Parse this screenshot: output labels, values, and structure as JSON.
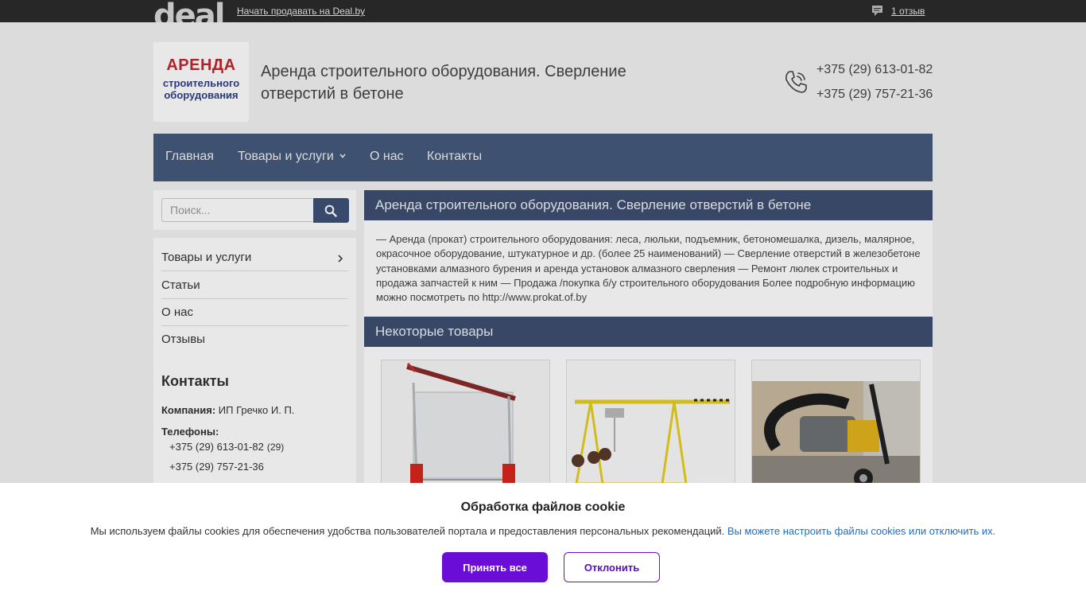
{
  "topbar": {
    "logo_text": "deal",
    "sell_link": "Начать продавать на Deal.by",
    "reviews_link": "1 отзыв",
    "comment_icon": "comment-icon"
  },
  "header": {
    "logo_lines": [
      "АРЕНДА",
      "строительного",
      "оборудования"
    ],
    "title": "Аренда строительного оборудования. Сверление отверстий в бетоне",
    "phone_icon": "phone-icon",
    "phones": [
      "+375 (29) 613-01-82",
      "+375 (29) 757-21-36"
    ]
  },
  "nav": {
    "items": [
      "Главная",
      "Товары и услуги",
      "О нас",
      "Контакты"
    ],
    "dropdown_icon": "chevron-down-icon"
  },
  "search": {
    "placeholder": "Поиск...",
    "button_icon": "search-icon"
  },
  "sidebar": {
    "items": [
      "Товары и услуги",
      "Статьи",
      "О нас",
      "Отзывы"
    ],
    "contacts_title": "Контакты",
    "company_label": "Компания:",
    "company_value": "ИП Гречко И. П.",
    "phones_label": "Телефоны:",
    "phones": [
      "+375 (29) 613-01-82",
      "+375 (29) 757-21-36"
    ],
    "phone_note": "(29)"
  },
  "main": {
    "heading": "Аренда строительного оборудования. Сверление отверстий в бетоне",
    "description": "— Аренда (прокат) строительного оборудования: леса, люльки, подъемник, бетономешалка, дизель, малярное, окрасочное оборудование, штукатурное и др. (более 25 наименований) — Сверление отверстий в железобетоне установками алмазного бурения и аренда установок алмазного сверления — Ремонт люлек строительных и продажа запчастей к ним — Продажа /покупка б/у строительного оборудования Более подробную информацию можно посмотреть по http://www.prokat.of.by",
    "products_heading": "Некоторые товары"
  },
  "cookie": {
    "title": "Обработка файлов cookie",
    "text": "Мы используем файлы cookies для обеспечения удобства пользователей портала и предоставления персональных рекомендаций.",
    "link": "Вы можете настроить файлы cookies или отключить их.",
    "accept": "Принять все",
    "decline": "Отклонить",
    "accent_color": "#6a0dd6",
    "link_color": "#1a6fc9"
  },
  "colors": {
    "nav_bg": "#455a7d",
    "section_head_bg": "#3d4f70",
    "topbar_bg": "#2b2b2b"
  }
}
